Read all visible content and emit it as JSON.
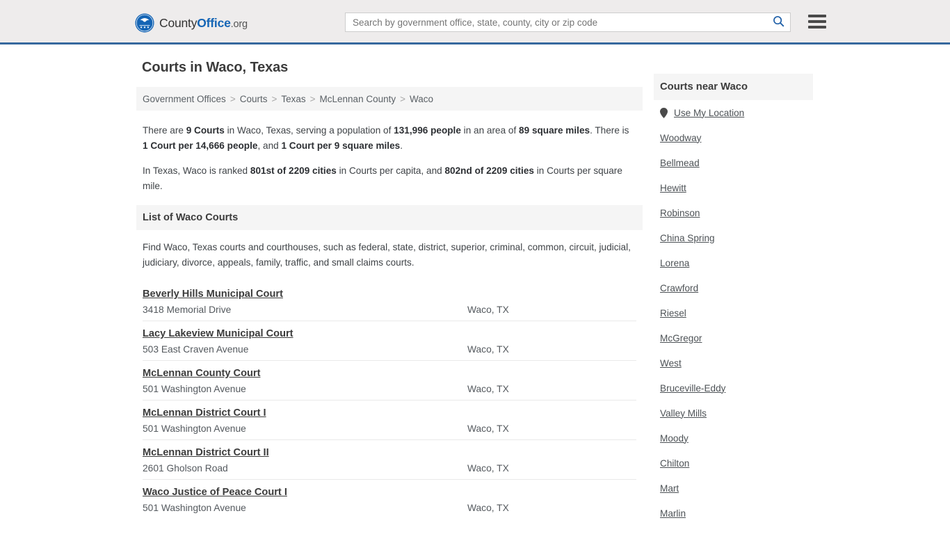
{
  "header": {
    "logo": {
      "icon": "eagle-shield-logo-icon",
      "text_county": "County",
      "text_office": "Office",
      "text_tld": ".org"
    },
    "search": {
      "placeholder": "Search by government office, state, county, city or zip code",
      "value": "",
      "search_icon": "search-icon"
    },
    "menu_icon": "hamburger-menu-icon",
    "accent_color": "#37699e",
    "background_color": "#eeecec"
  },
  "main": {
    "title": "Courts in Waco, Texas",
    "breadcrumb": {
      "separator": ">",
      "items": [
        {
          "label": "Government Offices"
        },
        {
          "label": "Courts"
        },
        {
          "label": "Texas"
        },
        {
          "label": "McLennan County"
        },
        {
          "label": "Waco"
        }
      ]
    },
    "intro_paragraphs": [
      {
        "parts": [
          {
            "text": "There are ",
            "bold": false
          },
          {
            "text": "9 Courts",
            "bold": true
          },
          {
            "text": " in Waco, Texas, serving a population of ",
            "bold": false
          },
          {
            "text": "131,996 people",
            "bold": true
          },
          {
            "text": " in an area of ",
            "bold": false
          },
          {
            "text": "89 square miles",
            "bold": true
          },
          {
            "text": ". There is ",
            "bold": false
          },
          {
            "text": "1 Court per 14,666 people",
            "bold": true
          },
          {
            "text": ", and ",
            "bold": false
          },
          {
            "text": "1 Court per 9 square miles",
            "bold": true
          },
          {
            "text": ".",
            "bold": false
          }
        ]
      },
      {
        "parts": [
          {
            "text": "In Texas, Waco is ranked ",
            "bold": false
          },
          {
            "text": "801st of 2209 cities",
            "bold": true
          },
          {
            "text": " in Courts per capita, and ",
            "bold": false
          },
          {
            "text": "802nd of 2209 cities",
            "bold": true
          },
          {
            "text": " in Courts per square mile.",
            "bold": false
          }
        ]
      }
    ],
    "section_title": "List of Waco Courts",
    "section_description": "Find Waco, Texas courts and courthouses, such as federal, state, district, superior, criminal, common, circuit, judicial, judiciary, divorce, appeals, family, traffic, and small claims courts.",
    "courts": [
      {
        "name": "Beverly Hills Municipal Court",
        "address": "3418 Memorial Drive",
        "city": "Waco, TX"
      },
      {
        "name": "Lacy Lakeview Municipal Court",
        "address": "503 East Craven Avenue",
        "city": "Waco, TX"
      },
      {
        "name": "McLennan County Court",
        "address": "501 Washington Avenue",
        "city": "Waco, TX"
      },
      {
        "name": "McLennan District Court I",
        "address": "501 Washington Avenue",
        "city": "Waco, TX"
      },
      {
        "name": "McLennan District Court II",
        "address": "2601 Gholson Road",
        "city": "Waco, TX"
      },
      {
        "name": "Waco Justice of Peace Court I",
        "address": "501 Washington Avenue",
        "city": "Waco, TX"
      }
    ]
  },
  "sidebar": {
    "title": "Courts near Waco",
    "use_my_location": {
      "label": "Use My Location",
      "icon": "map-pin-icon"
    },
    "nearby": [
      {
        "label": "Woodway"
      },
      {
        "label": "Bellmead"
      },
      {
        "label": "Hewitt"
      },
      {
        "label": "Robinson"
      },
      {
        "label": "China Spring"
      },
      {
        "label": "Lorena"
      },
      {
        "label": "Crawford"
      },
      {
        "label": "Riesel"
      },
      {
        "label": "McGregor"
      },
      {
        "label": "West"
      },
      {
        "label": "Bruceville-Eddy"
      },
      {
        "label": "Valley Mills"
      },
      {
        "label": "Moody"
      },
      {
        "label": "Chilton"
      },
      {
        "label": "Mart"
      },
      {
        "label": "Marlin"
      }
    ]
  }
}
